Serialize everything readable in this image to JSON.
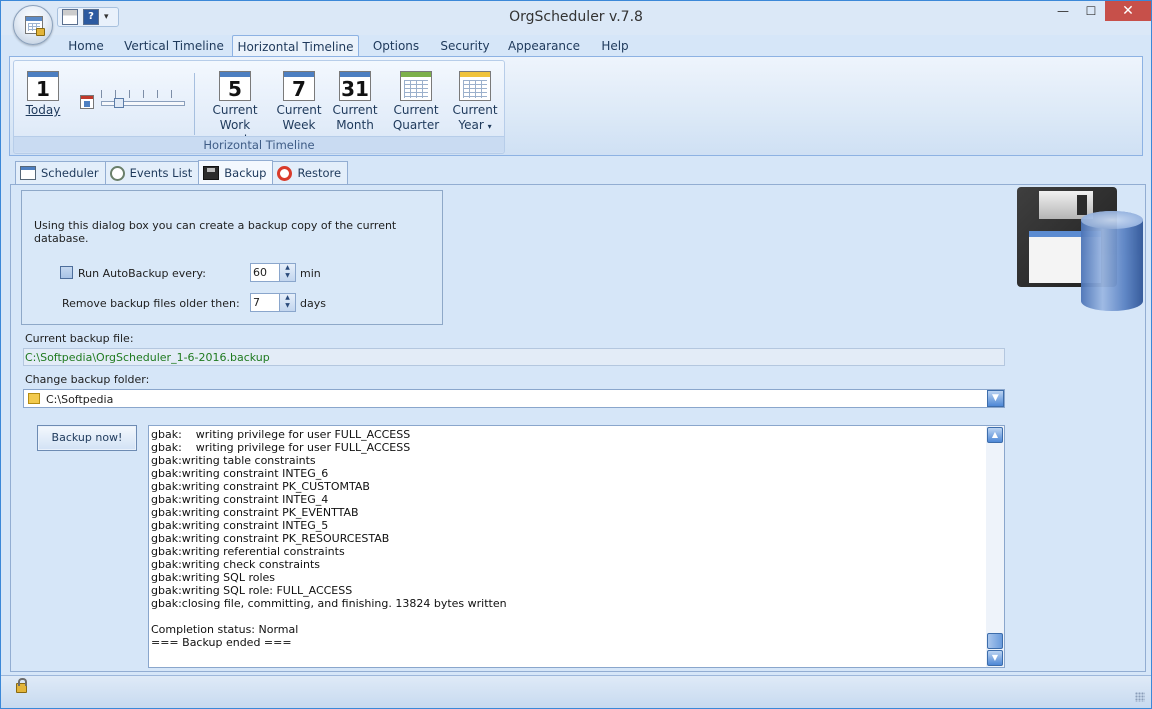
{
  "window": {
    "title": "OrgScheduler v.7.8",
    "controls": {
      "minimize": "—",
      "maximize": "☐",
      "close": "✕"
    }
  },
  "quick_access": {
    "print_icon": "printer-icon",
    "help_label": "?",
    "dropdown_label": "▾"
  },
  "ribbon": {
    "tabs": [
      {
        "label": "Home"
      },
      {
        "label": "Vertical Timeline"
      },
      {
        "label": "Horizontal Timeline"
      },
      {
        "label": "Options"
      },
      {
        "label": "Security"
      },
      {
        "label": "Appearance"
      },
      {
        "label": "Help"
      }
    ],
    "active_tab": "Horizontal Timeline",
    "group": {
      "label": "Horizontal Timeline",
      "today": {
        "num": "1",
        "label": "Today"
      },
      "buttons": [
        {
          "num": "5",
          "line1": "Current",
          "line2": "Work week"
        },
        {
          "num": "7",
          "line1": "Current",
          "line2": "Week"
        },
        {
          "num": "31",
          "line1": "Current",
          "line2": "Month"
        },
        {
          "num": "",
          "line1": "Current",
          "line2": "Quarter",
          "caret": "▾"
        },
        {
          "num": "",
          "line1": "Current",
          "line2": "Year",
          "caret": "▾"
        }
      ]
    }
  },
  "content_tabs": [
    {
      "label": "Scheduler",
      "icon": "calendar-grid-icon"
    },
    {
      "label": "Events List",
      "icon": "clock-icon"
    },
    {
      "label": "Backup",
      "icon": "floppy-disk-icon"
    },
    {
      "label": "Restore",
      "icon": "lifebuoy-icon"
    }
  ],
  "active_content_tab": "Backup",
  "backup": {
    "intro": "Using this dialog box you can create a backup copy of the current database.",
    "autobackup": {
      "label": "Run AutoBackup every:",
      "checked": false,
      "value": "60",
      "unit": "min"
    },
    "remove_old": {
      "label": "Remove backup files older then:",
      "value": "7",
      "unit": "days"
    },
    "current_file_label": "Current backup file:",
    "current_file": "C:\\Softpedia\\OrgScheduler_1-6-2016.backup",
    "change_folder_label": "Change backup folder:",
    "folder": "C:\\Softpedia",
    "button_label": "Backup now!",
    "log": [
      "gbak:    writing privilege for user FULL_ACCESS",
      "gbak:    writing privilege for user FULL_ACCESS",
      "gbak:writing table constraints",
      "gbak:writing constraint INTEG_6",
      "gbak:writing constraint PK_CUSTOMTAB",
      "gbak:writing constraint INTEG_4",
      "gbak:writing constraint PK_EVENTTAB",
      "gbak:writing constraint INTEG_5",
      "gbak:writing constraint PK_RESOURCESTAB",
      "gbak:writing referential constraints",
      "gbak:writing check constraints",
      "gbak:writing SQL roles",
      "gbak:writing SQL role: FULL_ACCESS",
      "gbak:closing file, committing, and finishing. 13824 bytes written",
      "",
      "Completion status: Normal",
      "=== Backup ended ==="
    ]
  },
  "colors": {
    "accent": "#3b88d8",
    "path_text": "#1f7a1f",
    "background": "#d6e6f8"
  }
}
